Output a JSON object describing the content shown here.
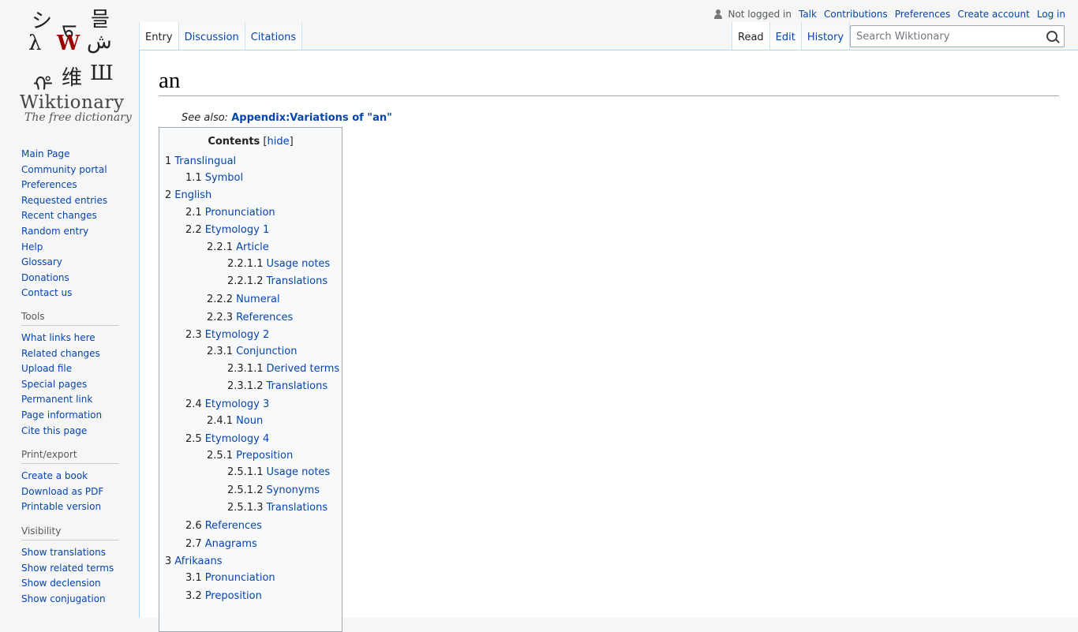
{
  "logo": {
    "wordmark": "Wiktionary",
    "tagline": "The free dictionary",
    "glyphs": [
      "シ",
      "ᠳ",
      "믈",
      "λ",
      "W",
      "ش",
      "ᡥ",
      "维",
      "Ш"
    ]
  },
  "personal": {
    "status": "Not logged in",
    "links": [
      "Talk",
      "Contributions",
      "Preferences",
      "Create account",
      "Log in"
    ]
  },
  "tabs": {
    "left": [
      "Entry",
      "Discussion",
      "Citations"
    ],
    "right": [
      "Read",
      "Edit",
      "History"
    ]
  },
  "search": {
    "placeholder": "Search Wiktionary"
  },
  "page": {
    "title": "an",
    "see_also_label": "See also:",
    "see_also_link": "Appendix:Variations of \"an\""
  },
  "toc": {
    "heading": "Contents",
    "hide": "hide",
    "items": [
      {
        "num": "1",
        "label": "Translingual",
        "level": 1
      },
      {
        "num": "1.1",
        "label": "Symbol",
        "level": 2
      },
      {
        "num": "2",
        "label": "English",
        "level": 1
      },
      {
        "num": "2.1",
        "label": "Pronunciation",
        "level": 2
      },
      {
        "num": "2.2",
        "label": "Etymology 1",
        "level": 2
      },
      {
        "num": "2.2.1",
        "label": "Article",
        "level": 3
      },
      {
        "num": "2.2.1.1",
        "label": "Usage notes",
        "level": 4
      },
      {
        "num": "2.2.1.2",
        "label": "Translations",
        "level": 4
      },
      {
        "num": "2.2.2",
        "label": "Numeral",
        "level": 3
      },
      {
        "num": "2.2.3",
        "label": "References",
        "level": 3
      },
      {
        "num": "2.3",
        "label": "Etymology 2",
        "level": 2
      },
      {
        "num": "2.3.1",
        "label": "Conjunction",
        "level": 3
      },
      {
        "num": "2.3.1.1",
        "label": "Derived terms",
        "level": 4
      },
      {
        "num": "2.3.1.2",
        "label": "Translations",
        "level": 4
      },
      {
        "num": "2.4",
        "label": "Etymology 3",
        "level": 2
      },
      {
        "num": "2.4.1",
        "label": "Noun",
        "level": 3
      },
      {
        "num": "2.5",
        "label": "Etymology 4",
        "level": 2
      },
      {
        "num": "2.5.1",
        "label": "Preposition",
        "level": 3
      },
      {
        "num": "2.5.1.1",
        "label": "Usage notes",
        "level": 4
      },
      {
        "num": "2.5.1.2",
        "label": "Synonyms",
        "level": 4
      },
      {
        "num": "2.5.1.3",
        "label": "Translations",
        "level": 4
      },
      {
        "num": "2.6",
        "label": "References",
        "level": 2
      },
      {
        "num": "2.7",
        "label": "Anagrams",
        "level": 2
      },
      {
        "num": "3",
        "label": "Afrikaans",
        "level": 1
      },
      {
        "num": "3.1",
        "label": "Pronunciation",
        "level": 2
      },
      {
        "num": "3.2",
        "label": "Preposition",
        "level": 2
      }
    ]
  },
  "sidebar": {
    "navigation": [
      "Main Page",
      "Community portal",
      "Preferences",
      "Requested entries",
      "Recent changes",
      "Random entry",
      "Help",
      "Glossary",
      "Donations",
      "Contact us"
    ],
    "tools_heading": "Tools",
    "tools": [
      "What links here",
      "Related changes",
      "Upload file",
      "Special pages",
      "Permanent link",
      "Page information",
      "Cite this page"
    ],
    "print_heading": "Print/export",
    "print": [
      "Create a book",
      "Download as PDF",
      "Printable version"
    ],
    "visibility_heading": "Visibility",
    "visibility": [
      "Show translations",
      "Show related terms",
      "Show declension",
      "Show conjugation"
    ]
  }
}
